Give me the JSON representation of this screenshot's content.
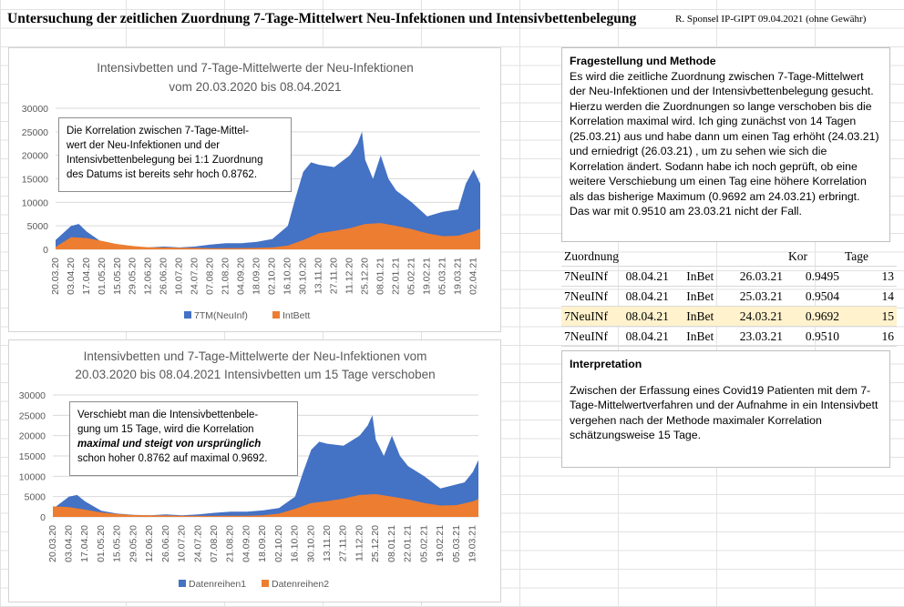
{
  "sheet": {
    "title": "Untersuchung der zeitlichen Zuordnung 7-Tage-Mittelwert Neu-Infektionen und Intensivbettenbelegung",
    "author": "R. Sponsel IP-GIPT 09.04.2021 (ohne Gewähr)"
  },
  "chart1": {
    "title_lines": [
      "Intensivbetten und 7-Tage-Mittelwerte der Neu-Infektionen",
      "vom 20.03.2020 bis 08.04.2021"
    ],
    "textbox_lines": [
      "Die Korrelation zwischen 7-Tage-Mittel-",
      "wert der Neu-Infektionen und der",
      "Intensivbettenbelegung bei 1:1 Zuordnung",
      "des Datums ist bereits sehr hoch 0.8762."
    ],
    "legend": [
      "7TM(NeuInf)",
      "IntBett"
    ]
  },
  "chart2": {
    "title_lines": [
      "Intensivbetten und 7-Tage-Mittelwerte der Neu-Infektionen vom",
      "20.03.2020 bis 08.04.2021 Intensivbetten um 15 Tage verschoben"
    ],
    "textbox_lines": [
      "Verschiebt man die Intensivbettenbele-",
      "gung um 15 Tage, wird die Korrelation",
      "maximal und steigt von ursprünglich",
      "schon hoher 0.8762 auf maximal 0.9692."
    ],
    "legend": [
      "Datenreihen1",
      "Datenreihen2"
    ]
  },
  "method": {
    "heading": "Fragestellung und Methode",
    "text": "Es wird die zeitliche Zuordnung zwischen 7-Tage-Mittelwert der Neu-Infektionen und der Intensivbettenbelegung gesucht. Hierzu werden die Zuordnungen so lange verschoben bis die Korrelation maximal wird. Ich ging zunächst von 14 Tagen (25.03.21) aus und habe dann um einen Tag erhöht (24.03.21) und erniedrigt (26.03.21) , um zu sehen wie sich die Korrelation ändert. Sodann habe ich noch geprüft, ob eine weitere Verschiebung um einen Tag eine höhere Korrelation als das bisherige Maximum (0.9692 am 24.03.21) erbringt. Das war mit 0.9510 am 23.03.21 nicht der Fall."
  },
  "table": {
    "headers": [
      "Zuordnung",
      "Kor",
      "Tage"
    ],
    "rows": [
      [
        "7NeuINf",
        "08.04.21",
        "InBet",
        "26.03.21",
        "0.9495",
        "13"
      ],
      [
        "7NeuINf",
        "08.04.21",
        "InBet",
        "25.03.21",
        "0.9504",
        "14"
      ],
      [
        "7NeuINf",
        "08.04.21",
        "InBet",
        "24.03.21",
        "0.9692",
        "15"
      ],
      [
        "7NeuINf",
        "08.04.21",
        "InBet",
        "23.03.21",
        "0.9510",
        "16"
      ]
    ]
  },
  "interpretation": {
    "heading": "Interpretation",
    "text": "Zwischen der Erfassung eines Covid19 Patienten mit dem 7-Tage-Mittelwertverfahren und der Aufnahme in ein Intensivbett vergehen nach der Methode maximaler Korrelation schätzungsweise 15 Tage."
  },
  "colors": {
    "infections": "#4472c4",
    "icu": "#ed7d31",
    "highlight": "#fff2cc"
  },
  "chart_data": [
    {
      "type": "area",
      "ylim": [
        0,
        30000
      ],
      "yticks": [
        0,
        5000,
        10000,
        15000,
        20000,
        25000,
        30000
      ],
      "xticks": [
        "20.03.20",
        "03.04.20",
        "17.04.20",
        "01.05.20",
        "15.05.20",
        "29.05.20",
        "12.06.20",
        "26.06.20",
        "10.07.20",
        "24.07.20",
        "07.08.20",
        "21.08.20",
        "04.09.20",
        "18.09.20",
        "02.10.20",
        "16.10.20",
        "30.10.20",
        "13.11.20",
        "27.11.20",
        "11.12.20",
        "25.12.20",
        "08.01.21",
        "22.01.21",
        "05.02.21",
        "19.02.21",
        "05.03.21",
        "19.03.21",
        "02.04.21"
      ],
      "series": [
        {
          "name": "7TM(NeuInf)",
          "x": [
            "20.03.20",
            "03.04.20",
            "10.04.20",
            "17.04.20",
            "01.05.20",
            "15.05.20",
            "29.05.20",
            "12.06.20",
            "26.06.20",
            "10.07.20",
            "24.07.20",
            "07.08.20",
            "21.08.20",
            "04.09.20",
            "18.09.20",
            "02.10.20",
            "16.10.20",
            "23.10.20",
            "30.10.20",
            "06.11.20",
            "13.11.20",
            "27.11.20",
            "11.12.20",
            "18.12.20",
            "22.12.20",
            "25.12.20",
            "01.01.21",
            "08.01.21",
            "15.01.21",
            "22.01.21",
            "05.02.21",
            "19.02.21",
            "05.03.21",
            "19.03.21",
            "26.03.21",
            "02.04.21",
            "08.04.21"
          ],
          "values": [
            2000,
            5000,
            5400,
            3800,
            1500,
            800,
            500,
            400,
            600,
            400,
            600,
            1000,
            1300,
            1300,
            1600,
            2200,
            5000,
            11000,
            16500,
            18500,
            18000,
            17500,
            20000,
            22500,
            25000,
            19000,
            15000,
            20000,
            15000,
            12500,
            10000,
            7000,
            8000,
            8500,
            14000,
            17000,
            14000
          ]
        },
        {
          "name": "IntBett",
          "x": [
            "20.03.20",
            "03.04.20",
            "17.04.20",
            "01.05.20",
            "15.05.20",
            "29.05.20",
            "12.06.20",
            "26.06.20",
            "10.07.20",
            "24.07.20",
            "07.08.20",
            "21.08.20",
            "04.09.20",
            "18.09.20",
            "02.10.20",
            "16.10.20",
            "30.10.20",
            "13.11.20",
            "27.11.20",
            "11.12.20",
            "25.12.20",
            "08.01.21",
            "22.01.21",
            "05.02.21",
            "19.02.21",
            "05.03.21",
            "19.03.21",
            "02.04.21",
            "08.04.21"
          ],
          "values": [
            500,
            2600,
            2400,
            1800,
            1100,
            700,
            450,
            400,
            350,
            300,
            250,
            250,
            280,
            300,
            400,
            800,
            2000,
            3400,
            3900,
            4500,
            5400,
            5600,
            5000,
            4300,
            3400,
            2800,
            2900,
            3800,
            4400
          ]
        }
      ]
    },
    {
      "type": "area",
      "ylim": [
        0,
        30000
      ],
      "yticks": [
        0,
        5000,
        10000,
        15000,
        20000,
        25000,
        30000
      ],
      "xticks": [
        "20.03.20",
        "03.04.20",
        "17.04.20",
        "01.05.20",
        "15.05.20",
        "29.05.20",
        "12.06.20",
        "26.06.20",
        "10.07.20",
        "24.07.20",
        "07.08.20",
        "21.08.20",
        "04.09.20",
        "18.09.20",
        "02.10.20",
        "16.10.20",
        "30.10.20",
        "13.11.20",
        "27.11.20",
        "11.12.20",
        "25.12.20",
        "08.01.21",
        "22.01.21",
        "05.02.21",
        "19.02.21",
        "05.03.21",
        "19.03.21"
      ],
      "series": [
        {
          "name": "Datenreihen1",
          "x": [
            "20.03.20",
            "03.04.20",
            "10.04.20",
            "17.04.20",
            "01.05.20",
            "15.05.20",
            "29.05.20",
            "12.06.20",
            "26.06.20",
            "10.07.20",
            "24.07.20",
            "07.08.20",
            "21.08.20",
            "04.09.20",
            "18.09.20",
            "02.10.20",
            "16.10.20",
            "23.10.20",
            "30.10.20",
            "06.11.20",
            "13.11.20",
            "27.11.20",
            "11.12.20",
            "18.12.20",
            "22.12.20",
            "25.12.20",
            "01.01.21",
            "08.01.21",
            "15.01.21",
            "22.01.21",
            "05.02.21",
            "19.02.21",
            "05.03.21",
            "12.03.21",
            "19.03.21",
            "24.03.21"
          ],
          "values": [
            2000,
            5000,
            5400,
            3800,
            1500,
            800,
            500,
            400,
            600,
            400,
            600,
            1000,
            1300,
            1300,
            1600,
            2200,
            5000,
            11000,
            16500,
            18500,
            18000,
            17500,
            20000,
            22500,
            25000,
            19000,
            15000,
            20000,
            15000,
            12500,
            10000,
            7000,
            8000,
            8500,
            11000,
            14000
          ]
        },
        {
          "name": "Datenreihen2",
          "x": [
            "20.03.20",
            "03.04.20",
            "17.04.20",
            "01.05.20",
            "15.05.20",
            "29.05.20",
            "12.06.20",
            "26.06.20",
            "10.07.20",
            "24.07.20",
            "07.08.20",
            "21.08.20",
            "04.09.20",
            "18.09.20",
            "02.10.20",
            "16.10.20",
            "30.10.20",
            "13.11.20",
            "27.11.20",
            "11.12.20",
            "25.12.20",
            "08.01.21",
            "22.01.21",
            "05.02.21",
            "19.02.21",
            "05.03.21",
            "19.03.21",
            "24.03.21"
          ],
          "values": [
            2600,
            2400,
            1800,
            1100,
            700,
            450,
            400,
            350,
            300,
            250,
            250,
            280,
            300,
            400,
            800,
            2000,
            3400,
            3900,
            4500,
            5400,
            5600,
            5000,
            4300,
            3400,
            2800,
            2900,
            3800,
            4400
          ]
        }
      ]
    }
  ]
}
